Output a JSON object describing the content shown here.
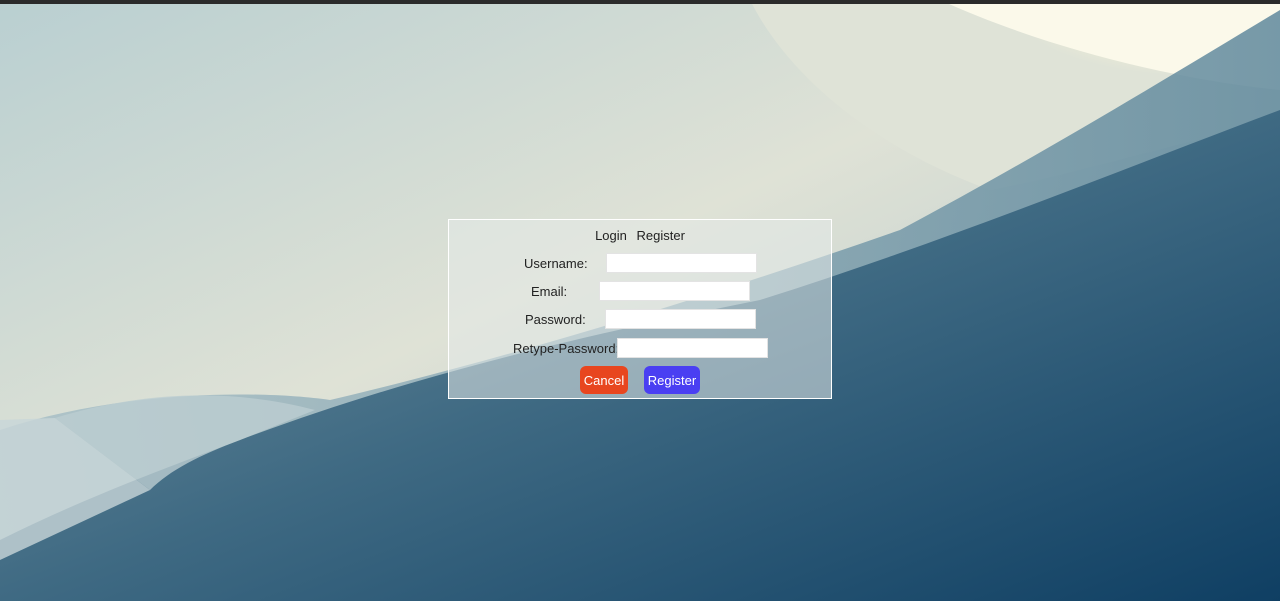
{
  "tabs": [
    {
      "label": "Login"
    },
    {
      "label": "Register"
    }
  ],
  "form": {
    "username_label": "Username:",
    "username_value": "",
    "email_label": "Email:",
    "email_value": "",
    "password_label": "Password:",
    "password_value": "",
    "retype_label": "Retype-Password:",
    "retype_value": ""
  },
  "buttons": {
    "cancel_label": "Cancel",
    "register_label": "Register"
  },
  "colors": {
    "cancel": "#e8461f",
    "register": "#4a3ff2"
  }
}
